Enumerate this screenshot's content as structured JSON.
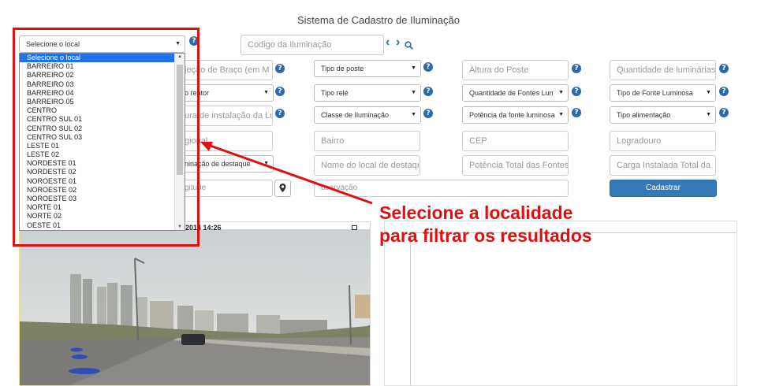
{
  "page": {
    "title": "Sistema de Cadastro de Iluminação"
  },
  "location_select": {
    "value": "Selecione o local",
    "options": [
      "Selecione o local",
      "BARREIRO 01",
      "BARREIRO 02",
      "BARREIRO 03",
      "BARREIRO 04",
      "BARREIRO 05",
      "CENTRO",
      "CENTRO SUL 01",
      "CENTRO SUL 02",
      "CENTRO SUL 03",
      "LESTE 01",
      "LESTE 02",
      "NORDESTE 01",
      "NORDESTE 02",
      "NOROESTE 01",
      "NOROESTE 02",
      "NOROESTE 03",
      "NORTE 01",
      "NORTE 02",
      "OESTE 01"
    ]
  },
  "search": {
    "placeholder": "Codigo da Iluminação"
  },
  "help_glyph": "?",
  "form": {
    "projecao_braco": "jeção de Braço (em M",
    "tipo_poste": "Tipo de poste",
    "altura_poste": "Altura do Poste",
    "quantidade_luminarias": "Quantidade de luminárias",
    "reator": "o reator",
    "tipo_rele": "Tipo relé",
    "quantidade_fontes": "Quantidade de Fontes Lun",
    "tipo_fonte": "Tipo de Fonte Luminosa",
    "altura_instalacao": "ura de instalação da Lu",
    "classe_iluminacao": "Classe de Iluminação",
    "potencia_fonte": "Potência da fonte luminosa",
    "tipo_alimentacao": "Tipo alimentação",
    "regional": "gional",
    "bairro": "Bairro",
    "cep": "CEP",
    "logradouro": "Logradouro",
    "iluminacao_destaque": "ninação de destaque",
    "nome_local_destaque": "Nome do local de destaqı",
    "potencia_total": "Potência Total das Fontes",
    "carga_instalada": "Carga Instalada Total da",
    "longitude": "gitude",
    "observacao": "bservação",
    "cadastrar": "Cadastrar"
  },
  "photo": {
    "timestamp": "2014 14:26"
  },
  "annotation": {
    "line1": "Selecione a localidade",
    "line2": "para filtrar os resultados"
  },
  "icons": {
    "prev": "‹",
    "next": "›",
    "search": "search-icon",
    "pin": "map-pin-icon",
    "caret": "▼"
  },
  "colors": {
    "primary": "#337ab7",
    "help": "#2f6aa8",
    "annotation_red": "#e01010",
    "option_selected": "#1e73e8"
  }
}
